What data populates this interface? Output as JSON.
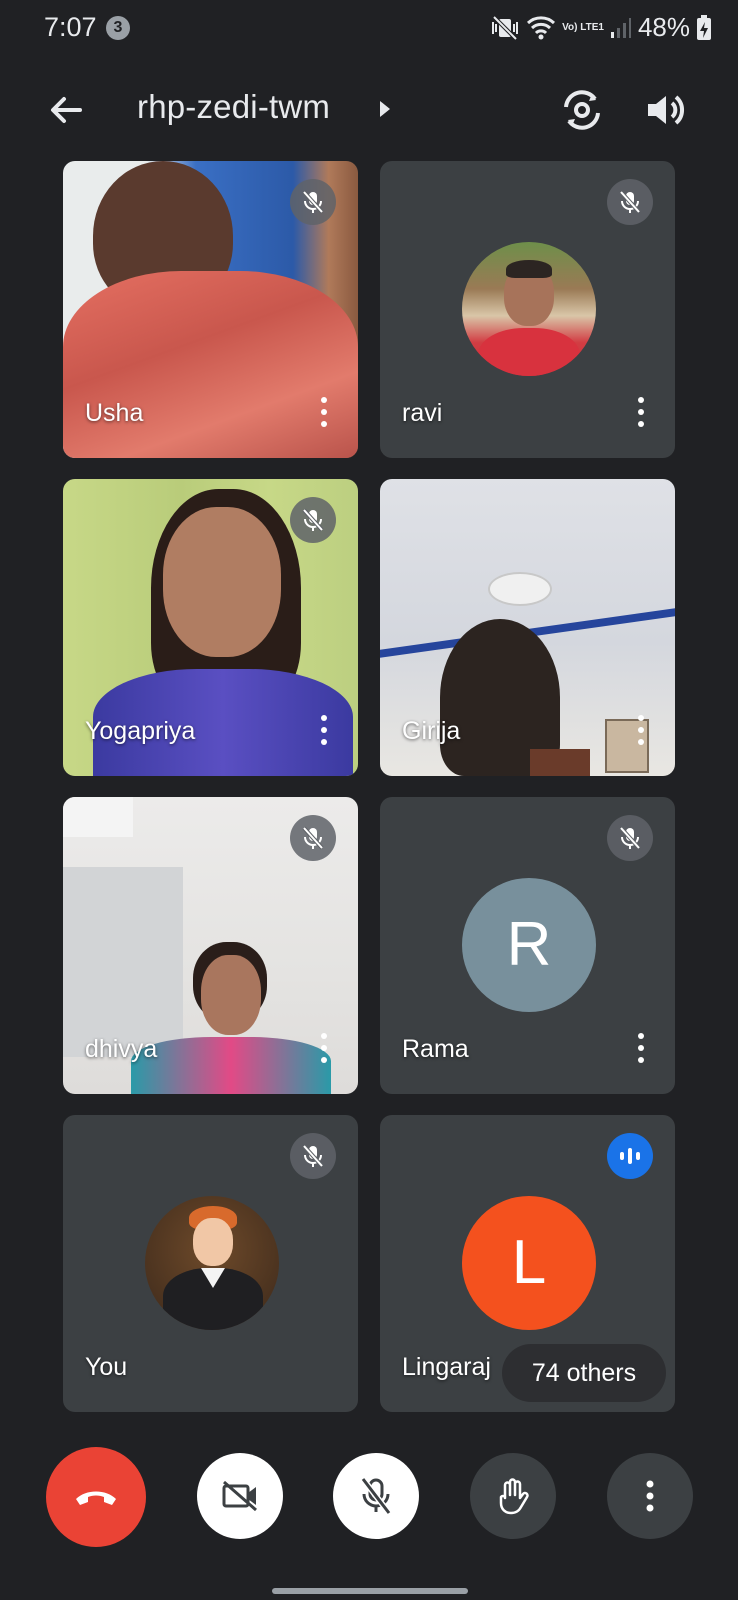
{
  "status_bar": {
    "time": "7:07",
    "notification_count": "3",
    "network_label": "Vo) LTE1",
    "battery": "48%"
  },
  "app_bar": {
    "meeting_code": "rhp-zedi-twm"
  },
  "tiles": [
    {
      "name": "Usha",
      "muted": true,
      "view": "camera"
    },
    {
      "name": "ravi",
      "muted": true,
      "view": "profile-photo"
    },
    {
      "name": "Yogapriya",
      "muted": true,
      "view": "camera"
    },
    {
      "name": "Girija",
      "muted": false,
      "view": "camera"
    },
    {
      "name": "dhivya",
      "muted": true,
      "view": "camera"
    },
    {
      "name": "Rama",
      "muted": true,
      "view": "letter-avatar",
      "avatar_letter": "R",
      "avatar_color": "#78909c"
    },
    {
      "name": "You",
      "muted": true,
      "view": "profile-photo"
    },
    {
      "name": "Lingaraj",
      "muted": false,
      "speaking": true,
      "view": "letter-avatar",
      "avatar_letter": "L",
      "avatar_color": "#f4511e"
    }
  ],
  "others_pill": "74 others",
  "controls": {
    "end_call_color": "#ea4335",
    "icons": [
      "phone-hangup-icon",
      "videocam-off-icon",
      "mic-off-icon",
      "raise-hand-icon",
      "more-vert-icon"
    ]
  }
}
